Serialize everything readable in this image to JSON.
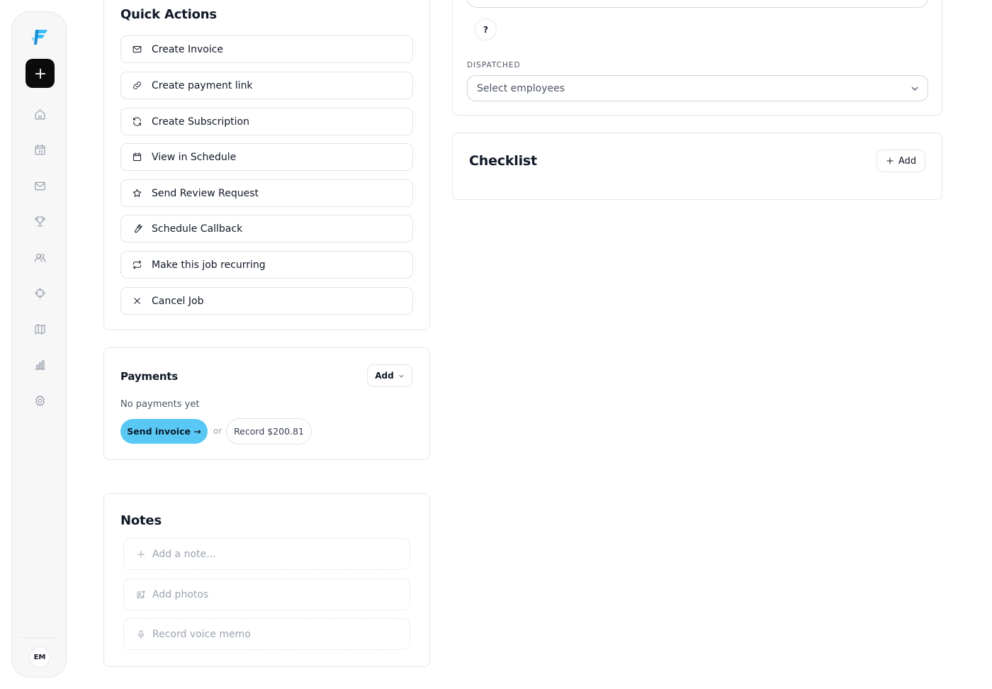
{
  "sidebar": {
    "avatar_initials": "EM",
    "nav": [
      "home-icon",
      "calendar-icon",
      "mail-icon",
      "trophy-icon",
      "users-icon",
      "crosshair-icon",
      "map-icon",
      "bar-chart-icon",
      "gear-icon"
    ]
  },
  "quick_actions": {
    "title": "Quick Actions",
    "items": [
      {
        "label": "Create Invoice",
        "icon": "mail-icon"
      },
      {
        "label": "Create payment link",
        "icon": "link-icon"
      },
      {
        "label": "Create Subscription",
        "icon": "refresh-icon"
      },
      {
        "label": "View in Schedule",
        "icon": "calendar-icon"
      },
      {
        "label": "Send Review Request",
        "icon": "star-icon"
      },
      {
        "label": "Schedule Callback",
        "icon": "wrench-icon"
      },
      {
        "label": "Make this job recurring",
        "icon": "repeat-icon"
      },
      {
        "label": "Cancel Job",
        "icon": "x-icon"
      }
    ]
  },
  "payments": {
    "title": "Payments",
    "add_label": "Add",
    "empty_text": "No payments yet",
    "send_invoice_label": "Send invoice →",
    "or_text": "or",
    "record_label": "Record $200.81"
  },
  "notes": {
    "title": "Notes",
    "add_note_label": "Add a note...",
    "add_photos_label": "Add photos",
    "voice_memo_label": "Record voice memo"
  },
  "dispatch": {
    "help_label": "?",
    "label": "DISPATCHED",
    "select_placeholder": "Select employees"
  },
  "checklist": {
    "title": "Checklist",
    "add_label": "Add"
  },
  "colors": {
    "accent": "#5ac8f5",
    "primary_dark": "#0b0b0b",
    "border": "#e5e7eb"
  }
}
